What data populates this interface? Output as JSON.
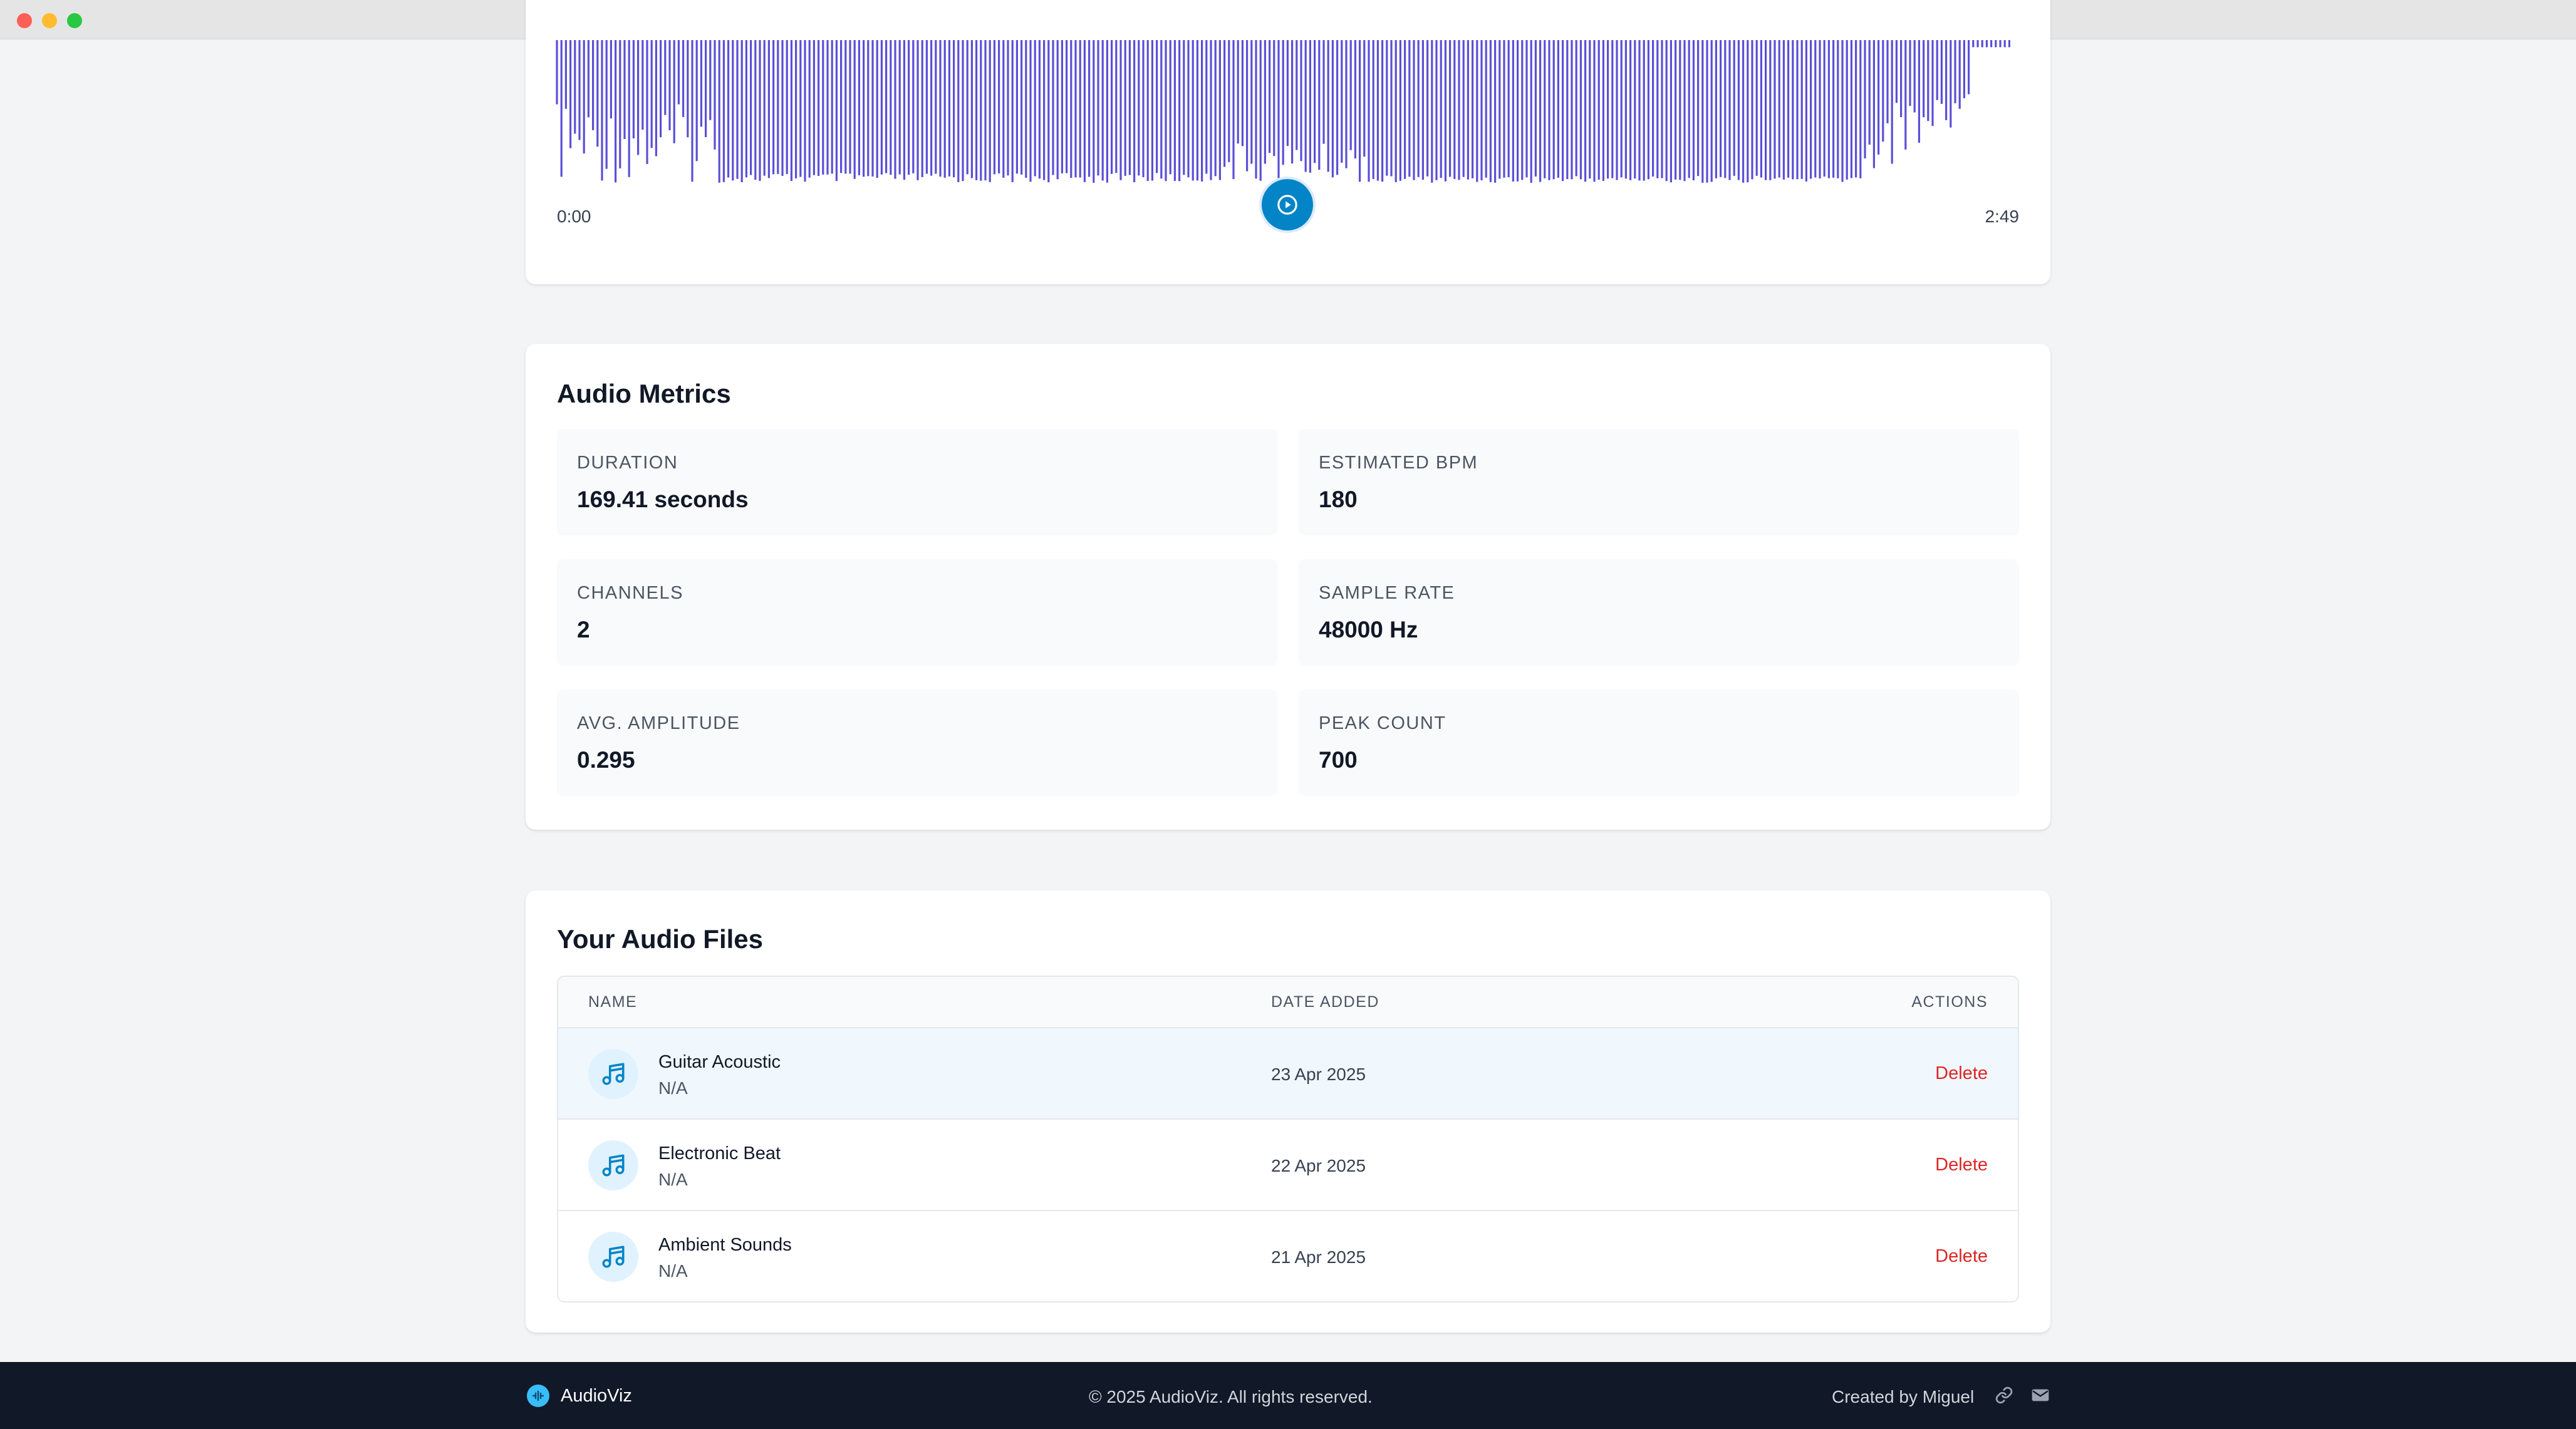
{
  "player": {
    "time_start": "0:00",
    "time_end": "2:49",
    "play_icon": "play-circle-icon",
    "wave_color": "#5b4fd6",
    "accent": "#0284c7"
  },
  "metrics": {
    "title": "Audio Metrics",
    "items": [
      {
        "label": "DURATION",
        "value": "169.41 seconds"
      },
      {
        "label": "ESTIMATED BPM",
        "value": "180"
      },
      {
        "label": "CHANNELS",
        "value": "2"
      },
      {
        "label": "SAMPLE RATE",
        "value": "48000 Hz"
      },
      {
        "label": "AVG. AMPLITUDE",
        "value": "0.295"
      },
      {
        "label": "PEAK COUNT",
        "value": "700"
      }
    ]
  },
  "files": {
    "title": "Your Audio Files",
    "columns": {
      "name": "NAME",
      "date": "DATE ADDED",
      "actions": "ACTIONS"
    },
    "rows": [
      {
        "name": "Guitar Acoustic",
        "sub": "N/A",
        "date": "23 Apr 2025",
        "action": "Delete",
        "icon": "music-note-icon"
      },
      {
        "name": "Electronic Beat",
        "sub": "N/A",
        "date": "22 Apr 2025",
        "action": "Delete",
        "icon": "music-note-icon"
      },
      {
        "name": "Ambient Sounds",
        "sub": "N/A",
        "date": "21 Apr 2025",
        "action": "Delete",
        "icon": "music-note-icon"
      }
    ],
    "delete_color": "#dc2626"
  },
  "footer": {
    "brand": "AudioViz",
    "copyright": "© 2025 AudioViz. All rights reserved.",
    "credit": "Created by Miguel",
    "icons": [
      "link-icon",
      "mail-icon"
    ]
  }
}
